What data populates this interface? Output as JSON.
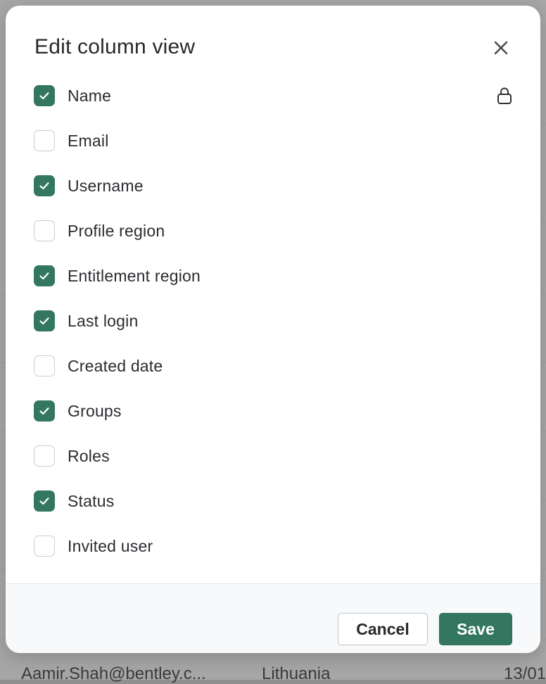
{
  "modal": {
    "title": "Edit column view",
    "close_icon": "close-icon",
    "columns": [
      {
        "label": "Name",
        "checked": true,
        "locked": true
      },
      {
        "label": "Email",
        "checked": false,
        "locked": false
      },
      {
        "label": "Username",
        "checked": true,
        "locked": false
      },
      {
        "label": "Profile region",
        "checked": false,
        "locked": false
      },
      {
        "label": "Entitlement region",
        "checked": true,
        "locked": false
      },
      {
        "label": "Last login",
        "checked": true,
        "locked": false
      },
      {
        "label": "Created date",
        "checked": false,
        "locked": false
      },
      {
        "label": "Groups",
        "checked": true,
        "locked": false
      },
      {
        "label": "Roles",
        "checked": false,
        "locked": false
      },
      {
        "label": "Status",
        "checked": true,
        "locked": false
      },
      {
        "label": "Invited user",
        "checked": false,
        "locked": false
      }
    ],
    "cancel_label": "Cancel",
    "save_label": "Save"
  },
  "background": {
    "row_email": "Aamir.Shah@bentley.c...",
    "row_country": "Lithuania",
    "row_date": "13/01/"
  },
  "colors": {
    "accent": "#337760",
    "checkbox_border": "#c9ccd1",
    "overlay": "#a6a6a6"
  }
}
